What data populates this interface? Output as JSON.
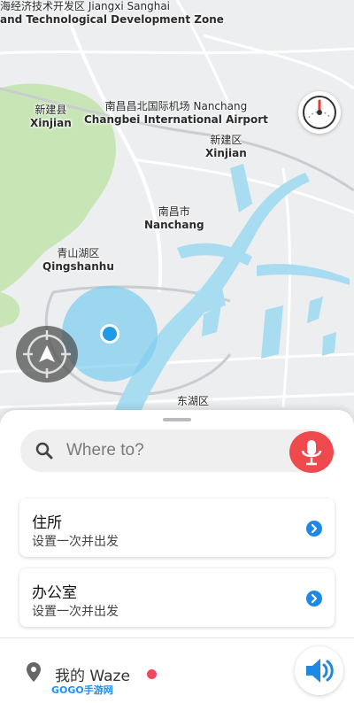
{
  "map": {
    "labels": {
      "zone": {
        "zh": "海经济技术开发区 Jiangxi Sanghai",
        "en": "and Technological Development Zone"
      },
      "xinjian_county": {
        "zh": "新建县",
        "en": "Xinjian"
      },
      "airport": {
        "zh": "南昌昌北国际机场 Nanchang",
        "en": "Changbei International Airport"
      },
      "xinjian_district": {
        "zh": "新建区",
        "en": "Xinjian"
      },
      "nanchang": {
        "zh": "南昌市",
        "en": "Nanchang"
      },
      "qingshanhu": {
        "zh": "青山湖区",
        "en": "Qingshanhu"
      },
      "donghu": {
        "zh": "东湖区"
      }
    },
    "colors": {
      "water": "#a8dcf0",
      "park": "#c8e6b5",
      "road": "#ffffff",
      "land": "#eceef0",
      "location_dot": "#1e9be6"
    }
  },
  "controls": {
    "speedometer_icon": "speedometer-icon",
    "recenter_icon": "recenter-icon"
  },
  "search": {
    "placeholder": "Where to?",
    "mic_color": "#ee4a4e"
  },
  "places": [
    {
      "title": "住所",
      "subtitle": "设置一次并出发"
    },
    {
      "title": "办公室",
      "subtitle": "设置一次并出发"
    }
  ],
  "bottom": {
    "my_waze": "我的 Waze",
    "watermark": "GOGO手游网"
  }
}
